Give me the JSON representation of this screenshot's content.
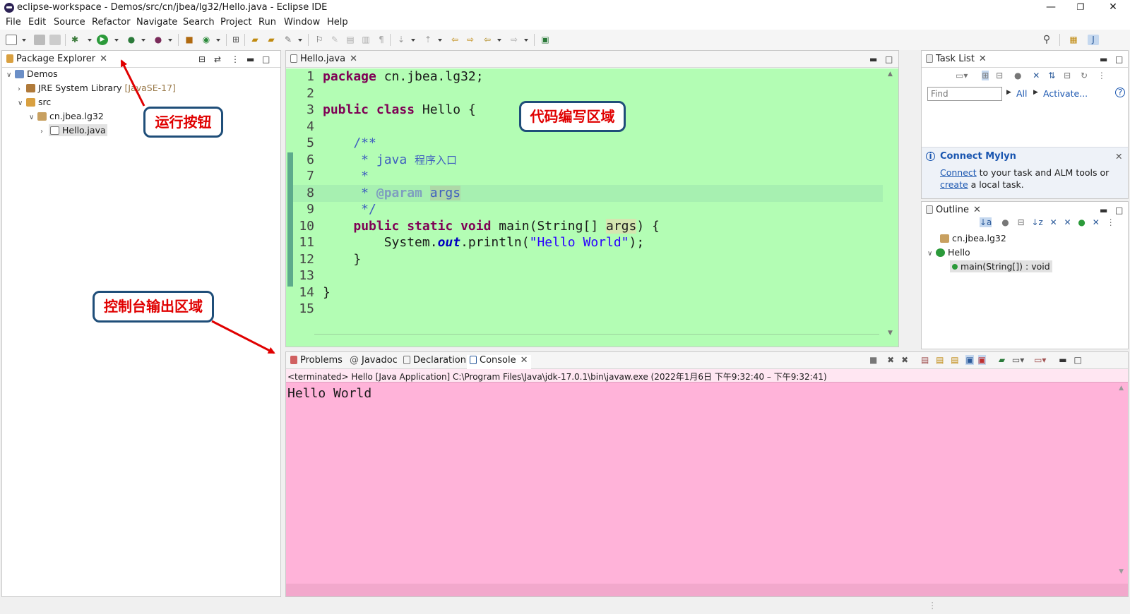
{
  "window": {
    "title": "eclipse-workspace - Demos/src/cn/jbea/lg32/Hello.java - Eclipse IDE",
    "minimize": "—",
    "restore": "❐",
    "close": "✕"
  },
  "menu": [
    "File",
    "Edit",
    "Source",
    "Refactor",
    "Navigate",
    "Search",
    "Project",
    "Run",
    "Window",
    "Help"
  ],
  "package_explorer": {
    "tab": "Package Explorer",
    "tree": [
      {
        "label": "Demos",
        "icon": "project-icon",
        "level": 0,
        "expanded": true
      },
      {
        "label": "JRE System Library",
        "suffix": "[JavaSE-17]",
        "icon": "library-icon",
        "level": 1,
        "expanded": false
      },
      {
        "label": "src",
        "icon": "folder-icon",
        "level": 1,
        "expanded": true
      },
      {
        "label": "cn.jbea.lg32",
        "icon": "package-icon",
        "level": 2,
        "expanded": true
      },
      {
        "label": "Hello.java",
        "icon": "java-file-icon",
        "level": 3,
        "expanded": false,
        "selected": true
      }
    ]
  },
  "editor": {
    "tab": "Hello.java",
    "background_color": "#b3fdb4",
    "lines": [
      "1",
      "2",
      "3",
      "4",
      "5",
      "6",
      "7",
      "8",
      "9",
      "10",
      "11",
      "12",
      "13",
      "14",
      "15"
    ],
    "code": {
      "l1_kw": "package",
      "l1_rest": " cn.jbea.lg32;",
      "l3_kw": "public class",
      "l3_rest": " Hello {",
      "l5": "    /**",
      "l6_a": "     * java ",
      "l6_b": "程序入口",
      "l7": "     *",
      "l8_a": "     * ",
      "l8_tag": "@param",
      "l8_arg": "args",
      "l9": "     */",
      "l10_kw": "public static void",
      "l10_a": " main(String[] ",
      "l10_arg": "args",
      "l10_b": ") {",
      "l11_a": "        System.",
      "l11_out": "out",
      "l11_b": ".println(",
      "l11_str": "\"Hello World\"",
      "l11_c": ");",
      "l12": "    }",
      "l14": "}"
    }
  },
  "task_list": {
    "tab": "Task List",
    "find_placeholder": "Find",
    "all": "All",
    "activate": "Activate...",
    "mylyn_title": "Connect Mylyn",
    "mylyn_connect": "Connect",
    "mylyn_text1": " to your task and ALM tools or",
    "mylyn_create": "create",
    "mylyn_text2": " a local task."
  },
  "outline": {
    "tab": "Outline",
    "items": [
      {
        "label": "cn.jbea.lg32",
        "icon": "package-icon"
      },
      {
        "label": "Hello",
        "icon": "class-icon"
      },
      {
        "label": "main(String[]) : void",
        "icon": "method-icon"
      }
    ]
  },
  "console": {
    "tabs": [
      "Problems",
      "Javadoc",
      "Declaration",
      "Console"
    ],
    "status": "<terminated> Hello [Java Application] C:\\Program Files\\Java\\jdk-17.0.1\\bin\\javaw.exe  (2022年1月6日 下午9:32:40 – 下午9:32:41)",
    "output": "Hello World",
    "background_color": "#ffb3d9"
  },
  "callouts": {
    "run_button": "运行按钮",
    "code_area": "代码编写区域",
    "console_area": "控制台输出区域"
  },
  "colors": {
    "annotation_red": "#e00000",
    "callout_border": "#1f4e79",
    "run_highlight": "#f4a7d6"
  }
}
